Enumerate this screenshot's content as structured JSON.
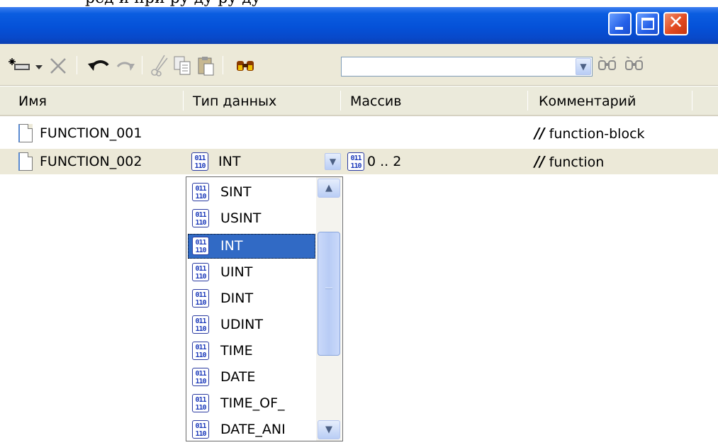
{
  "top_strip_text": "ред и при ру ду ру ду",
  "window": {
    "buttons": {
      "minimize_icon": "minimize-icon",
      "maximize_icon": "maximize-icon",
      "close_icon": "close-icon"
    },
    "title_color": "#0551d8"
  },
  "toolbar": {
    "search_value": "",
    "icons": [
      "new-var-icon",
      "dropdown-arrow-icon",
      "delete-icon",
      "undo-icon",
      "redo-icon",
      "cut-icon",
      "copy-icon",
      "paste-icon",
      "find-icon",
      "find-prev-icon",
      "find-next-icon"
    ]
  },
  "columns": {
    "name": "Имя",
    "type": "Тип данных",
    "array": "Массив",
    "comment": "Комментарий"
  },
  "rows": [
    {
      "name": "FUNCTION_001",
      "type": "",
      "array": "",
      "comment_prefix": "//",
      "comment": "function-block"
    },
    {
      "name": "FUNCTION_002",
      "type": "INT",
      "array": "0 .. 2",
      "comment_prefix": "//",
      "comment": "function"
    }
  ],
  "dropdown": {
    "selected": "INT",
    "items": [
      "SINT",
      "USINT",
      "INT",
      "UINT",
      "DINT",
      "UDINT",
      "TIME",
      "DATE",
      "TIME_OF_",
      "DATE_ANI"
    ]
  },
  "type_icon_glyph": "011\n110",
  "colors": {
    "selection": "#316ac5",
    "toolbar": "#ece9d8"
  }
}
